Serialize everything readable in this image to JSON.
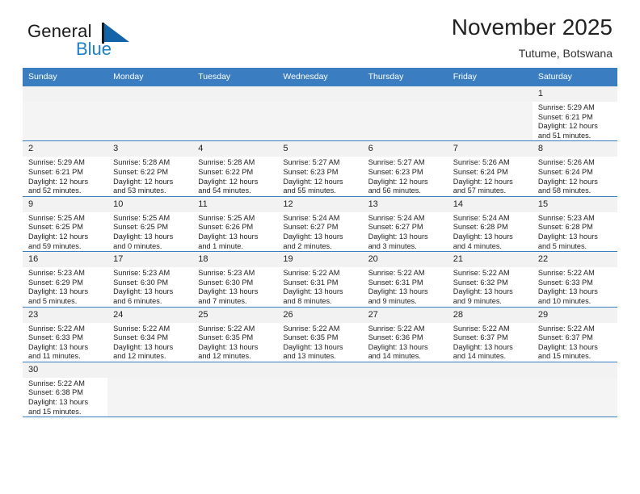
{
  "brand": {
    "name_top": "General",
    "name_bottom": "Blue",
    "flag_icon": "flag-triangle-icon",
    "accent_color": "#1f7fc4"
  },
  "header": {
    "title": "November 2025",
    "subtitle": "Tutume, Botswana"
  },
  "theme": {
    "header_row_bg": "#3a7dc0",
    "grid_line": "#3a7dc0",
    "daynum_bg": "#f2f2f2",
    "empty_cell_bg": "#f4f4f4"
  },
  "calendar": {
    "weekdays": [
      "Sunday",
      "Monday",
      "Tuesday",
      "Wednesday",
      "Thursday",
      "Friday",
      "Saturday"
    ],
    "labels": {
      "sunrise": "Sunrise:",
      "sunset": "Sunset:",
      "daylight": "Daylight:"
    },
    "weeks": [
      [
        {
          "day": "",
          "sunrise": "",
          "sunset": "",
          "daylight_1": "",
          "daylight_2": "",
          "empty": true
        },
        {
          "day": "",
          "sunrise": "",
          "sunset": "",
          "daylight_1": "",
          "daylight_2": "",
          "empty": true
        },
        {
          "day": "",
          "sunrise": "",
          "sunset": "",
          "daylight_1": "",
          "daylight_2": "",
          "empty": true
        },
        {
          "day": "",
          "sunrise": "",
          "sunset": "",
          "daylight_1": "",
          "daylight_2": "",
          "empty": true
        },
        {
          "day": "",
          "sunrise": "",
          "sunset": "",
          "daylight_1": "",
          "daylight_2": "",
          "empty": true
        },
        {
          "day": "",
          "sunrise": "",
          "sunset": "",
          "daylight_1": "",
          "daylight_2": "",
          "empty": true
        },
        {
          "day": "1",
          "sunrise": "Sunrise: 5:29 AM",
          "sunset": "Sunset: 6:21 PM",
          "daylight_1": "Daylight: 12 hours",
          "daylight_2": "and 51 minutes.",
          "empty": false
        }
      ],
      [
        {
          "day": "2",
          "sunrise": "Sunrise: 5:29 AM",
          "sunset": "Sunset: 6:21 PM",
          "daylight_1": "Daylight: 12 hours",
          "daylight_2": "and 52 minutes.",
          "empty": false
        },
        {
          "day": "3",
          "sunrise": "Sunrise: 5:28 AM",
          "sunset": "Sunset: 6:22 PM",
          "daylight_1": "Daylight: 12 hours",
          "daylight_2": "and 53 minutes.",
          "empty": false
        },
        {
          "day": "4",
          "sunrise": "Sunrise: 5:28 AM",
          "sunset": "Sunset: 6:22 PM",
          "daylight_1": "Daylight: 12 hours",
          "daylight_2": "and 54 minutes.",
          "empty": false
        },
        {
          "day": "5",
          "sunrise": "Sunrise: 5:27 AM",
          "sunset": "Sunset: 6:23 PM",
          "daylight_1": "Daylight: 12 hours",
          "daylight_2": "and 55 minutes.",
          "empty": false
        },
        {
          "day": "6",
          "sunrise": "Sunrise: 5:27 AM",
          "sunset": "Sunset: 6:23 PM",
          "daylight_1": "Daylight: 12 hours",
          "daylight_2": "and 56 minutes.",
          "empty": false
        },
        {
          "day": "7",
          "sunrise": "Sunrise: 5:26 AM",
          "sunset": "Sunset: 6:24 PM",
          "daylight_1": "Daylight: 12 hours",
          "daylight_2": "and 57 minutes.",
          "empty": false
        },
        {
          "day": "8",
          "sunrise": "Sunrise: 5:26 AM",
          "sunset": "Sunset: 6:24 PM",
          "daylight_1": "Daylight: 12 hours",
          "daylight_2": "and 58 minutes.",
          "empty": false
        }
      ],
      [
        {
          "day": "9",
          "sunrise": "Sunrise: 5:25 AM",
          "sunset": "Sunset: 6:25 PM",
          "daylight_1": "Daylight: 12 hours",
          "daylight_2": "and 59 minutes.",
          "empty": false
        },
        {
          "day": "10",
          "sunrise": "Sunrise: 5:25 AM",
          "sunset": "Sunset: 6:25 PM",
          "daylight_1": "Daylight: 13 hours",
          "daylight_2": "and 0 minutes.",
          "empty": false
        },
        {
          "day": "11",
          "sunrise": "Sunrise: 5:25 AM",
          "sunset": "Sunset: 6:26 PM",
          "daylight_1": "Daylight: 13 hours",
          "daylight_2": "and 1 minute.",
          "empty": false
        },
        {
          "day": "12",
          "sunrise": "Sunrise: 5:24 AM",
          "sunset": "Sunset: 6:27 PM",
          "daylight_1": "Daylight: 13 hours",
          "daylight_2": "and 2 minutes.",
          "empty": false
        },
        {
          "day": "13",
          "sunrise": "Sunrise: 5:24 AM",
          "sunset": "Sunset: 6:27 PM",
          "daylight_1": "Daylight: 13 hours",
          "daylight_2": "and 3 minutes.",
          "empty": false
        },
        {
          "day": "14",
          "sunrise": "Sunrise: 5:24 AM",
          "sunset": "Sunset: 6:28 PM",
          "daylight_1": "Daylight: 13 hours",
          "daylight_2": "and 4 minutes.",
          "empty": false
        },
        {
          "day": "15",
          "sunrise": "Sunrise: 5:23 AM",
          "sunset": "Sunset: 6:28 PM",
          "daylight_1": "Daylight: 13 hours",
          "daylight_2": "and 5 minutes.",
          "empty": false
        }
      ],
      [
        {
          "day": "16",
          "sunrise": "Sunrise: 5:23 AM",
          "sunset": "Sunset: 6:29 PM",
          "daylight_1": "Daylight: 13 hours",
          "daylight_2": "and 5 minutes.",
          "empty": false
        },
        {
          "day": "17",
          "sunrise": "Sunrise: 5:23 AM",
          "sunset": "Sunset: 6:30 PM",
          "daylight_1": "Daylight: 13 hours",
          "daylight_2": "and 6 minutes.",
          "empty": false
        },
        {
          "day": "18",
          "sunrise": "Sunrise: 5:23 AM",
          "sunset": "Sunset: 6:30 PM",
          "daylight_1": "Daylight: 13 hours",
          "daylight_2": "and 7 minutes.",
          "empty": false
        },
        {
          "day": "19",
          "sunrise": "Sunrise: 5:22 AM",
          "sunset": "Sunset: 6:31 PM",
          "daylight_1": "Daylight: 13 hours",
          "daylight_2": "and 8 minutes.",
          "empty": false
        },
        {
          "day": "20",
          "sunrise": "Sunrise: 5:22 AM",
          "sunset": "Sunset: 6:31 PM",
          "daylight_1": "Daylight: 13 hours",
          "daylight_2": "and 9 minutes.",
          "empty": false
        },
        {
          "day": "21",
          "sunrise": "Sunrise: 5:22 AM",
          "sunset": "Sunset: 6:32 PM",
          "daylight_1": "Daylight: 13 hours",
          "daylight_2": "and 9 minutes.",
          "empty": false
        },
        {
          "day": "22",
          "sunrise": "Sunrise: 5:22 AM",
          "sunset": "Sunset: 6:33 PM",
          "daylight_1": "Daylight: 13 hours",
          "daylight_2": "and 10 minutes.",
          "empty": false
        }
      ],
      [
        {
          "day": "23",
          "sunrise": "Sunrise: 5:22 AM",
          "sunset": "Sunset: 6:33 PM",
          "daylight_1": "Daylight: 13 hours",
          "daylight_2": "and 11 minutes.",
          "empty": false
        },
        {
          "day": "24",
          "sunrise": "Sunrise: 5:22 AM",
          "sunset": "Sunset: 6:34 PM",
          "daylight_1": "Daylight: 13 hours",
          "daylight_2": "and 12 minutes.",
          "empty": false
        },
        {
          "day": "25",
          "sunrise": "Sunrise: 5:22 AM",
          "sunset": "Sunset: 6:35 PM",
          "daylight_1": "Daylight: 13 hours",
          "daylight_2": "and 12 minutes.",
          "empty": false
        },
        {
          "day": "26",
          "sunrise": "Sunrise: 5:22 AM",
          "sunset": "Sunset: 6:35 PM",
          "daylight_1": "Daylight: 13 hours",
          "daylight_2": "and 13 minutes.",
          "empty": false
        },
        {
          "day": "27",
          "sunrise": "Sunrise: 5:22 AM",
          "sunset": "Sunset: 6:36 PM",
          "daylight_1": "Daylight: 13 hours",
          "daylight_2": "and 14 minutes.",
          "empty": false
        },
        {
          "day": "28",
          "sunrise": "Sunrise: 5:22 AM",
          "sunset": "Sunset: 6:37 PM",
          "daylight_1": "Daylight: 13 hours",
          "daylight_2": "and 14 minutes.",
          "empty": false
        },
        {
          "day": "29",
          "sunrise": "Sunrise: 5:22 AM",
          "sunset": "Sunset: 6:37 PM",
          "daylight_1": "Daylight: 13 hours",
          "daylight_2": "and 15 minutes.",
          "empty": false
        }
      ],
      [
        {
          "day": "30",
          "sunrise": "Sunrise: 5:22 AM",
          "sunset": "Sunset: 6:38 PM",
          "daylight_1": "Daylight: 13 hours",
          "daylight_2": "and 15 minutes.",
          "empty": false
        },
        {
          "day": "",
          "sunrise": "",
          "sunset": "",
          "daylight_1": "",
          "daylight_2": "",
          "empty": true
        },
        {
          "day": "",
          "sunrise": "",
          "sunset": "",
          "daylight_1": "",
          "daylight_2": "",
          "empty": true
        },
        {
          "day": "",
          "sunrise": "",
          "sunset": "",
          "daylight_1": "",
          "daylight_2": "",
          "empty": true
        },
        {
          "day": "",
          "sunrise": "",
          "sunset": "",
          "daylight_1": "",
          "daylight_2": "",
          "empty": true
        },
        {
          "day": "",
          "sunrise": "",
          "sunset": "",
          "daylight_1": "",
          "daylight_2": "",
          "empty": true
        },
        {
          "day": "",
          "sunrise": "",
          "sunset": "",
          "daylight_1": "",
          "daylight_2": "",
          "empty": true
        }
      ]
    ]
  }
}
